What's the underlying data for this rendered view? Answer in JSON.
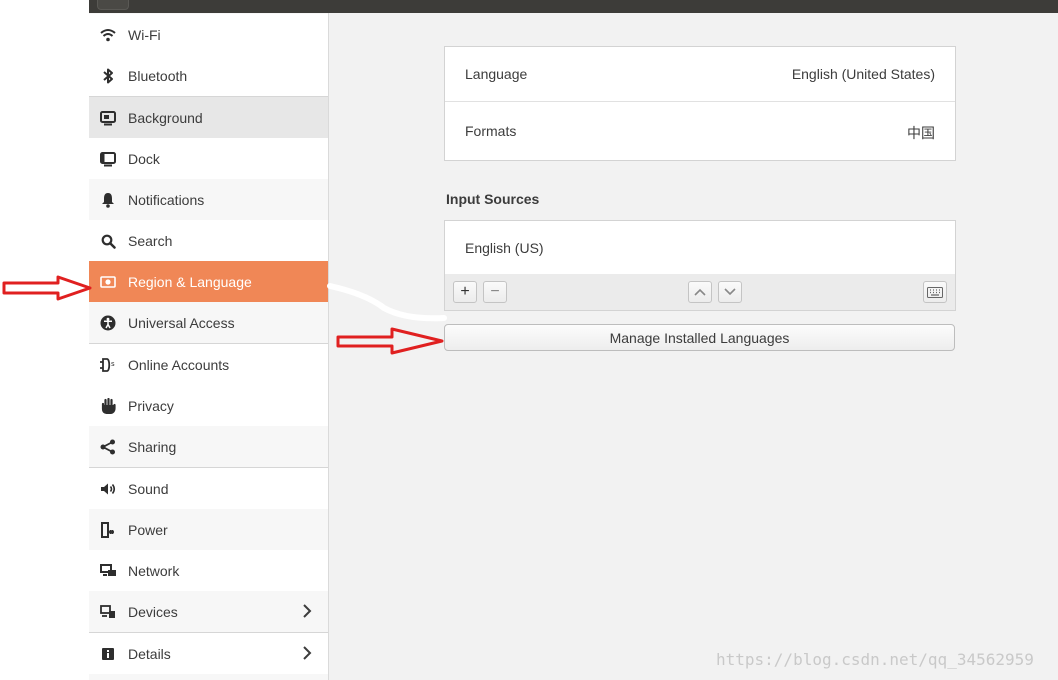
{
  "window": {
    "titlebar": ""
  },
  "sidebar": {
    "items": [
      {
        "label": "Wi-Fi",
        "icon": "wifi-icon"
      },
      {
        "label": "Bluetooth",
        "icon": "bluetooth-icon"
      },
      {
        "label": "Background",
        "icon": "background-icon"
      },
      {
        "label": "Dock",
        "icon": "dock-icon"
      },
      {
        "label": "Notifications",
        "icon": "bell-icon"
      },
      {
        "label": "Search",
        "icon": "search-icon"
      },
      {
        "label": "Region & Language",
        "icon": "region-icon"
      },
      {
        "label": "Universal Access",
        "icon": "accessibility-icon"
      },
      {
        "label": "Online Accounts",
        "icon": "online-accounts-icon"
      },
      {
        "label": "Privacy",
        "icon": "hand-icon"
      },
      {
        "label": "Sharing",
        "icon": "share-icon"
      },
      {
        "label": "Sound",
        "icon": "speaker-icon"
      },
      {
        "label": "Power",
        "icon": "power-icon"
      },
      {
        "label": "Network",
        "icon": "network-icon"
      },
      {
        "label": "Devices",
        "icon": "devices-icon"
      },
      {
        "label": "Details",
        "icon": "info-icon"
      }
    ],
    "selected": "Region & Language",
    "selected_color": "#f08756"
  },
  "main": {
    "language": {
      "label": "Language",
      "value": "English (United States)"
    },
    "formats": {
      "label": "Formats",
      "value": "中国"
    },
    "input_sources": {
      "title": "Input Sources",
      "items": [
        "English (US)"
      ],
      "add_label": "+",
      "remove_label": "−"
    },
    "manage_button": "Manage Installed Languages"
  },
  "watermark": "https://blog.csdn.net/qq_34562959",
  "annotation_color": "#e02020"
}
